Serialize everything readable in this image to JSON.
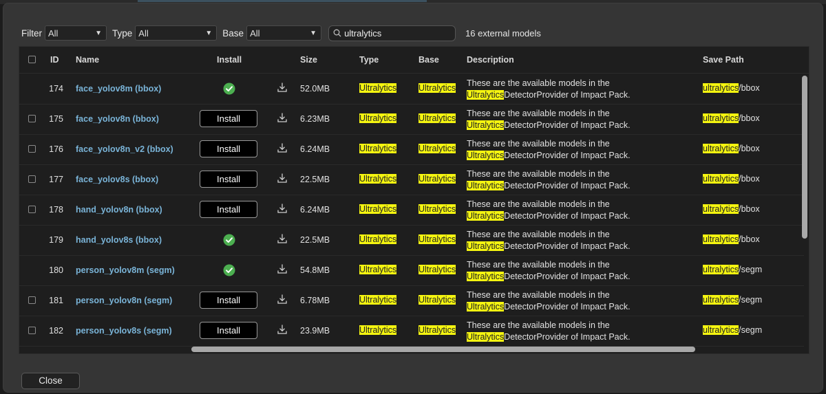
{
  "filter_bar": {
    "filter_label": "Filter",
    "filter_value": "All",
    "type_label": "Type",
    "type_value": "All",
    "base_label": "Base",
    "base_value": "All",
    "search_value": "ultralytics",
    "count_text": "16 external models"
  },
  "table": {
    "headers": {
      "id": "ID",
      "name": "Name",
      "install": "Install",
      "size": "Size",
      "type": "Type",
      "base": "Base",
      "description": "Description",
      "save_path": "Save Path"
    },
    "highlight_color": "#f5f510",
    "rows": [
      {
        "id": "174",
        "name": "face_yolov8m (bbox)",
        "installed": true,
        "size": "52.0MB",
        "type": "Ultralytics",
        "base": "Ultralytics",
        "desc_line1": "These are the available models in the",
        "desc_hl": "Ultralytics",
        "desc_rest": "DetectorProvider of Impact Pack.",
        "path_hl": "ultralytics",
        "path_rest": "/bbox"
      },
      {
        "id": "175",
        "name": "face_yolov8n (bbox)",
        "installed": false,
        "install_label": "Install",
        "size": "6.23MB",
        "type": "Ultralytics",
        "base": "Ultralytics",
        "desc_line1": "These are the available models in the",
        "desc_hl": "Ultralytics",
        "desc_rest": "DetectorProvider of Impact Pack.",
        "path_hl": "ultralytics",
        "path_rest": "/bbox"
      },
      {
        "id": "176",
        "name": "face_yolov8n_v2 (bbox)",
        "installed": false,
        "install_label": "Install",
        "size": "6.24MB",
        "type": "Ultralytics",
        "base": "Ultralytics",
        "desc_line1": "These are the available models in the",
        "desc_hl": "Ultralytics",
        "desc_rest": "DetectorProvider of Impact Pack.",
        "path_hl": "ultralytics",
        "path_rest": "/bbox"
      },
      {
        "id": "177",
        "name": "face_yolov8s (bbox)",
        "installed": false,
        "install_label": "Install",
        "size": "22.5MB",
        "type": "Ultralytics",
        "base": "Ultralytics",
        "desc_line1": "These are the available models in the",
        "desc_hl": "Ultralytics",
        "desc_rest": "DetectorProvider of Impact Pack.",
        "path_hl": "ultralytics",
        "path_rest": "/bbox"
      },
      {
        "id": "178",
        "name": "hand_yolov8n (bbox)",
        "installed": false,
        "install_label": "Install",
        "size": "6.24MB",
        "type": "Ultralytics",
        "base": "Ultralytics",
        "desc_line1": "These are the available models in the",
        "desc_hl": "Ultralytics",
        "desc_rest": "DetectorProvider of Impact Pack.",
        "path_hl": "ultralytics",
        "path_rest": "/bbox"
      },
      {
        "id": "179",
        "name": "hand_yolov8s (bbox)",
        "installed": true,
        "size": "22.5MB",
        "type": "Ultralytics",
        "base": "Ultralytics",
        "desc_line1": "These are the available models in the",
        "desc_hl": "Ultralytics",
        "desc_rest": "DetectorProvider of Impact Pack.",
        "path_hl": "ultralytics",
        "path_rest": "/bbox"
      },
      {
        "id": "180",
        "name": "person_yolov8m (segm)",
        "installed": true,
        "size": "54.8MB",
        "type": "Ultralytics",
        "base": "Ultralytics",
        "desc_line1": "These are the available models in the",
        "desc_hl": "Ultralytics",
        "desc_rest": "DetectorProvider of Impact Pack.",
        "path_hl": "ultralytics",
        "path_rest": "/segm"
      },
      {
        "id": "181",
        "name": "person_yolov8n (segm)",
        "installed": false,
        "install_label": "Install",
        "size": "6.78MB",
        "type": "Ultralytics",
        "base": "Ultralytics",
        "desc_line1": "These are the available models in the",
        "desc_hl": "Ultralytics",
        "desc_rest": "DetectorProvider of Impact Pack.",
        "path_hl": "ultralytics",
        "path_rest": "/segm"
      },
      {
        "id": "182",
        "name": "person_yolov8s (segm)",
        "installed": false,
        "install_label": "Install",
        "size": "23.9MB",
        "type": "Ultralytics",
        "base": "Ultralytics",
        "desc_line1": "These are the available models in the",
        "desc_hl": "Ultralytics",
        "desc_rest": "DetectorProvider of Impact Pack.",
        "path_hl": "ultralytics",
        "path_rest": "/segm"
      }
    ]
  },
  "footer": {
    "close_label": "Close"
  },
  "icons": {
    "installed": "check-circle-icon",
    "download": "download-icon",
    "search": "search-icon"
  },
  "colors": {
    "link": "#7ab4d8",
    "installed_green": "#4caf50"
  }
}
